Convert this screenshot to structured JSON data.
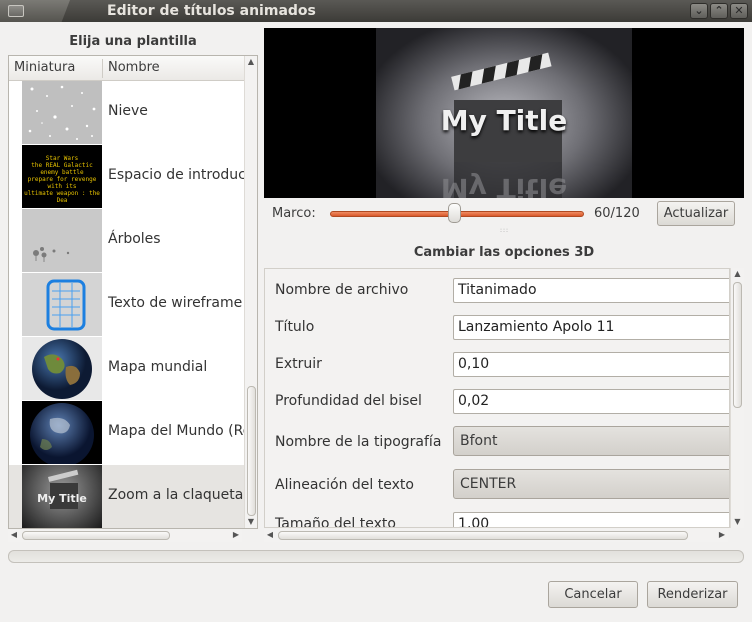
{
  "window": {
    "title": "Editor de títulos animados",
    "buttons": [
      "⌄",
      "⌃",
      "✕"
    ]
  },
  "templates": {
    "heading": "Elija una plantilla",
    "columns": [
      "Miniatura",
      "Nombre"
    ],
    "items": [
      {
        "name": "Nieve",
        "thumb": "snow"
      },
      {
        "name": "Espacio de introducción",
        "thumb": "space"
      },
      {
        "name": "Árboles",
        "thumb": "trees"
      },
      {
        "name": "Texto de wireframe",
        "thumb": "wireframe"
      },
      {
        "name": "Mapa mundial",
        "thumb": "globe"
      },
      {
        "name": "Mapa del Mundo (Rep",
        "thumb": "earth"
      },
      {
        "name": "Zoom a la claqueta",
        "thumb": "clapper",
        "selected": true
      }
    ],
    "space_thumb_text": [
      "Star Wars",
      "the REAL Galactic",
      "enemy battle",
      "prepare for revenge with its",
      "ultimate weapon : the Dea"
    ],
    "clapper_thumb_text": "My Title"
  },
  "preview": {
    "title_text": "My Title",
    "reflection_text": "My Title"
  },
  "frame": {
    "label": "Marco:",
    "value": "60/120",
    "current": 60,
    "total": 120,
    "update_button": "Actualizar"
  },
  "options": {
    "heading": "Cambiar las opciones 3D",
    "fields": [
      {
        "label": "Nombre de archivo",
        "value": "Titanimado",
        "kind": "input"
      },
      {
        "label": "Título",
        "value": "Lanzamiento Apolo 11",
        "kind": "input"
      },
      {
        "label": "Extruir",
        "value": "0,10",
        "kind": "input"
      },
      {
        "label": "Profundidad del bisel",
        "value": "0,02",
        "kind": "input"
      },
      {
        "label": "Nombre de la tipografía",
        "value": "Bfont",
        "kind": "select"
      },
      {
        "label": "Alineación del texto",
        "value": "CENTER",
        "kind": "select"
      },
      {
        "label": "Tamaño del texto",
        "value": "1,00",
        "kind": "input"
      }
    ]
  },
  "footer": {
    "cancel": "Cancelar",
    "render": "Renderizar",
    "progress": 0
  }
}
